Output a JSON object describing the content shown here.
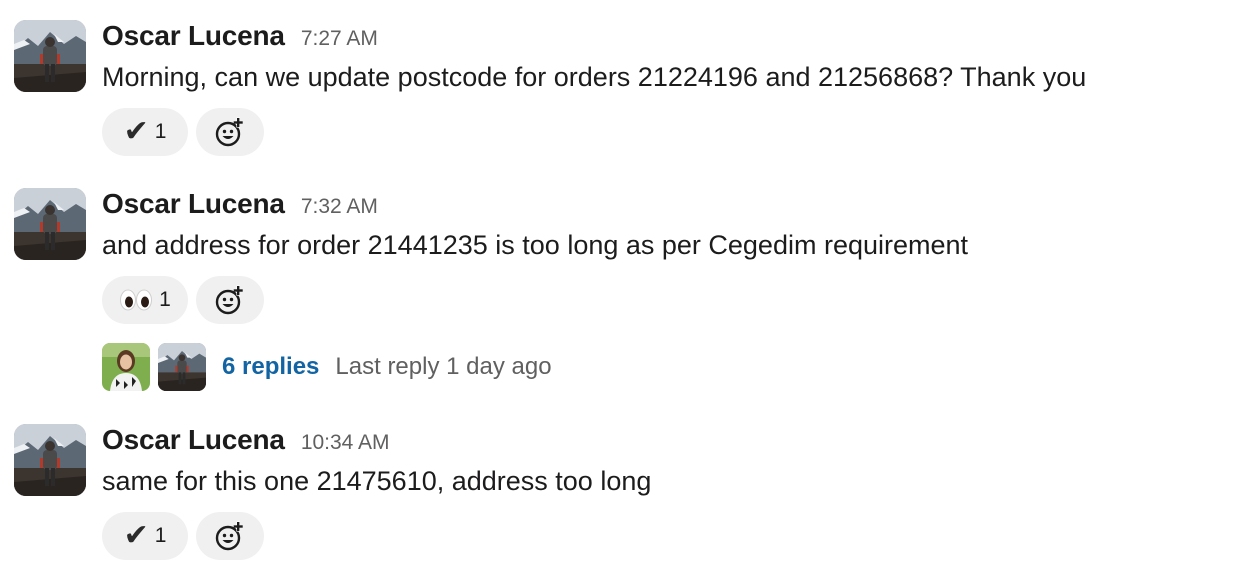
{
  "messages": [
    {
      "author": "Oscar Lucena",
      "time": "7:27 AM",
      "text": "Morning, can we update postcode for orders 21224196 and 21256868? Thank you",
      "reaction": {
        "emoji": "heavy-check-mark",
        "count": "1"
      }
    },
    {
      "author": "Oscar Lucena",
      "time": "7:32 AM",
      "text": "and address for order 21441235 is too long as per Cegedim requirement",
      "reaction": {
        "emoji": "eyes",
        "count": "1"
      },
      "thread": {
        "replies": "6 replies",
        "last_reply": "Last reply 1 day ago"
      }
    },
    {
      "author": "Oscar Lucena",
      "time": "10:34 AM",
      "text": "same for this one 21475610, address too long",
      "reaction": {
        "emoji": "heavy-check-mark",
        "count": "1"
      }
    }
  ],
  "colors": {
    "link": "#1264a3",
    "muted": "#616061",
    "pill_bg": "#f0f0f0",
    "text": "#1d1c1d"
  }
}
